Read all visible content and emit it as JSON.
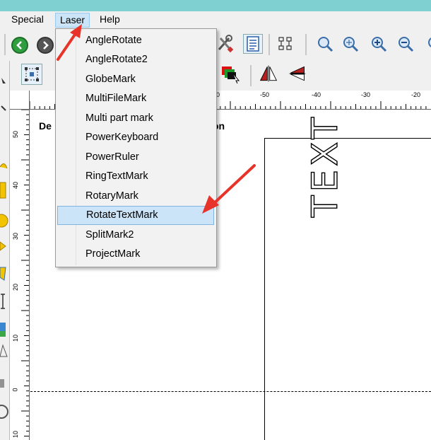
{
  "menubar": {
    "items": [
      {
        "label": "Special",
        "active": false
      },
      {
        "label": "Laser",
        "active": true
      },
      {
        "label": "Help",
        "active": false
      }
    ]
  },
  "laser_menu": {
    "items": [
      {
        "label": "AngleRotate",
        "highlighted": false
      },
      {
        "label": "AngleRotate2",
        "highlighted": false
      },
      {
        "label": "GlobeMark",
        "highlighted": false
      },
      {
        "label": "MultiFileMark",
        "highlighted": false
      },
      {
        "label": "Multi part mark",
        "highlighted": false
      },
      {
        "label": "PowerKeyboard",
        "highlighted": false
      },
      {
        "label": "PowerRuler",
        "highlighted": false
      },
      {
        "label": "RingTextMark",
        "highlighted": false
      },
      {
        "label": "RotaryMark",
        "highlighted": false
      },
      {
        "label": "RotateTextMark",
        "highlighted": true
      },
      {
        "label": "SplitMark2",
        "highlighted": false
      },
      {
        "label": "ProjectMark",
        "highlighted": false
      }
    ]
  },
  "canvas": {
    "title_left": "De",
    "title_right": "on",
    "text_object": "TEXT"
  },
  "hruler": {
    "labels": [
      "0",
      "-50",
      "-40",
      "-30",
      "-20"
    ]
  },
  "vruler": {
    "labels": [
      "50",
      "40",
      "30",
      "20",
      "10",
      "0",
      "10"
    ]
  },
  "colors": {
    "title_strip": "#7fd0d0",
    "menu_highlight": "#cce4f7",
    "annotation_arrow": "#e8332a",
    "nav_green": "#2e9e3e",
    "nav_gray": "#555555"
  }
}
